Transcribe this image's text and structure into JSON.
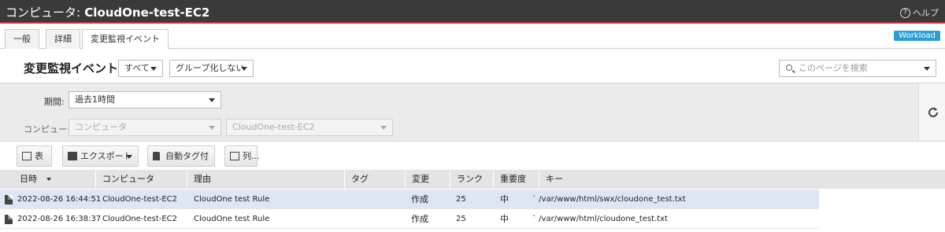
{
  "window": {
    "title_prefix": "コンピュータ:",
    "title_name": "CloudOne-test-EC2",
    "help_label": "ヘルプ",
    "help_icon": "question-circle-icon"
  },
  "tabs": [
    {
      "label": "一般",
      "active": false
    },
    {
      "label": "詳細",
      "active": false
    },
    {
      "label": "変更監視イベント",
      "active": true
    }
  ],
  "workload_badge": "Workload",
  "header": {
    "title": "変更監視イベント",
    "filter_all": "すべて",
    "grouping": "グループ化しない",
    "search_placeholder": "このページを検索"
  },
  "filters": {
    "period_label": "期間:",
    "period_value": "過去1時間",
    "computer_label": "コンピュータ:",
    "computer_value": "コンピュータ",
    "computer_name": "CloudOne-test-EC2"
  },
  "toolbar": {
    "view": "表示",
    "export": "エクスポート",
    "auto_tag": "自動タグ付け...",
    "columns": "列..."
  },
  "table": {
    "headers": {
      "datetime": "日時",
      "computer": "コンピュータ",
      "reason": "理由",
      "tag": "タグ",
      "change": "変更",
      "rank": "ランク",
      "severity": "重要度",
      "key": "キー"
    },
    "rows": [
      {
        "datetime": "2022-08-26 16:44:51",
        "computer": "CloudOne-test-EC2",
        "reason": "CloudOne test Rule",
        "tag": "",
        "change": "作成",
        "rank": "25",
        "severity": "中",
        "key": "` /var/www/html/swx/cloudone_test.txt"
      },
      {
        "datetime": "2022-08-26 16:38:37",
        "computer": "CloudOne-test-EC2",
        "reason": "CloudOne test Rule",
        "tag": "",
        "change": "作成",
        "rank": "25",
        "severity": "中",
        "key": "` /var/www/html/cloudone_test.txt"
      }
    ]
  },
  "colors": {
    "accent_red": "#cc3333",
    "titlebar": "#3a3a3a",
    "badge": "#2a9fd6",
    "selected_row": "#dfe6f3"
  }
}
